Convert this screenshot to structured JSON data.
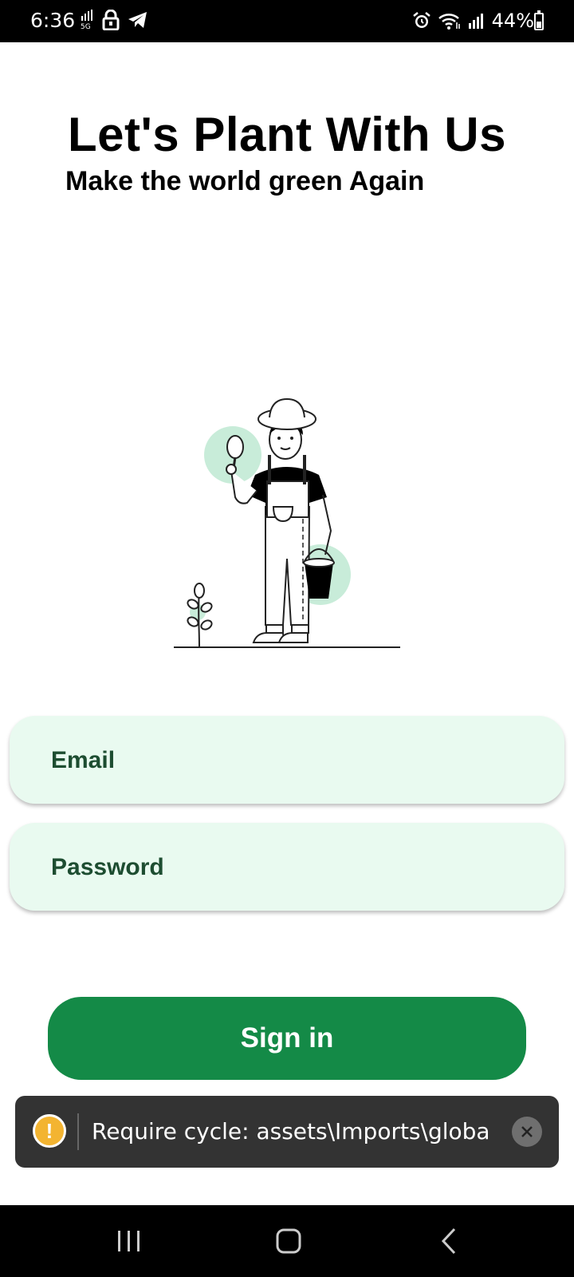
{
  "status_bar": {
    "time": "6:36",
    "battery": "44%",
    "battery_level": 0.44,
    "icons_left": [
      "data-signal-icon",
      "lock-icon",
      "telegram-icon"
    ],
    "icons_right": [
      "alarm-icon",
      "wifi-icon",
      "signal-icon",
      "battery-icon"
    ]
  },
  "header": {
    "title": "Let's Plant With Us",
    "subtitle": "Make the world green Again"
  },
  "illustration": {
    "icon": "gardener-illustration",
    "accent_color": "#c8ecd9"
  },
  "form": {
    "email_placeholder": "Email",
    "password_placeholder": "Password",
    "field_bg": "#e9faf0",
    "field_text_color": "#1d4d31"
  },
  "signin": {
    "label": "Sign in",
    "color": "#148a47"
  },
  "toast": {
    "message": "Require cycle: assets\\Imports\\globalI...",
    "warning_color": "#f3b431"
  },
  "nav_bar": {
    "buttons": [
      "recents-icon",
      "home-icon",
      "back-icon"
    ]
  }
}
